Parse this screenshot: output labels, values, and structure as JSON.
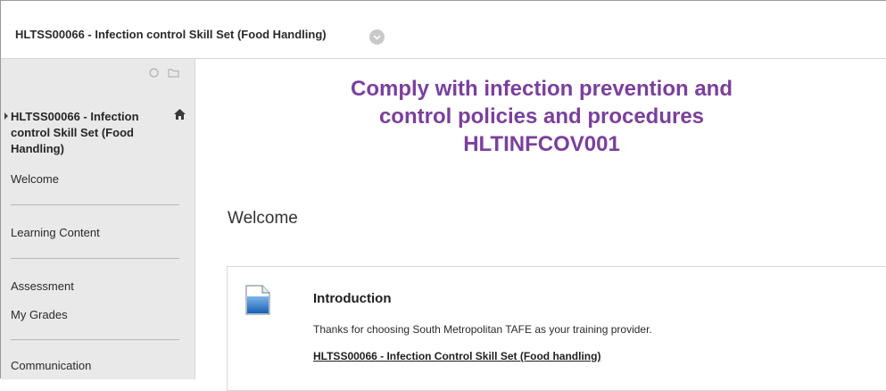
{
  "topbar": {
    "course_title": "HLTSS00066 - Infection control Skill Set (Food Handling)",
    "menu_icon": "chevron-down-circle-icon"
  },
  "sidebar": {
    "tool_icons": [
      "refresh-icon",
      "folder-icon"
    ],
    "course_name": "HLTSS00066 - Infection control Skill Set (Food Handling)",
    "home_icon": "home-icon",
    "items": [
      {
        "label": "Welcome"
      },
      {
        "label": "Learning Content"
      },
      {
        "label": "Assessment"
      },
      {
        "label": "My Grades"
      },
      {
        "label": "Communication"
      }
    ]
  },
  "main": {
    "banner": {
      "line1": "Comply with infection prevention and",
      "line2": "control policies and procedures",
      "line3": "HLTINFCOV001",
      "color": "#7b3f9e"
    },
    "page_heading": "Welcome",
    "content_item": {
      "icon": "document-icon",
      "title": "Introduction",
      "description": "Thanks for choosing South Metropolitan TAFE as your training provider.",
      "link_text": "HLTSS00066 - Infection Control Skill Set (Food handling)"
    }
  }
}
